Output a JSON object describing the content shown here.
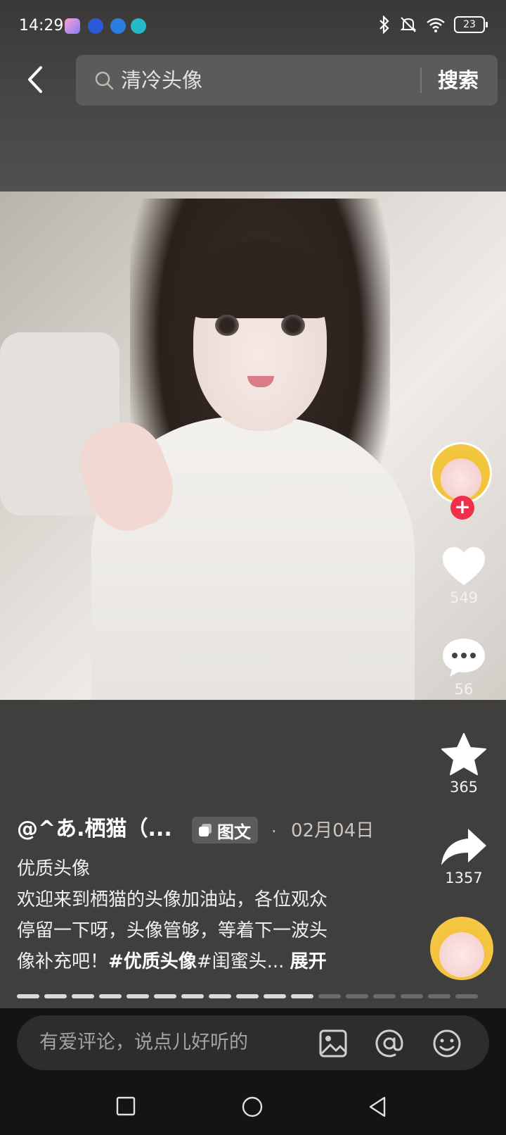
{
  "status_bar": {
    "time": "14:29",
    "battery": "23"
  },
  "search": {
    "query": "清冷头像",
    "submit_label": "搜索"
  },
  "post": {
    "author": "@^あ.栖猫（...",
    "type_tag": "图文",
    "date": "02月04日",
    "title": "优质头像",
    "body_line1": "欢迎来到栖猫的头像加油站，各位观众",
    "body_line2": "停留一下呀，头像管够，等着下一波头",
    "body_line3_prefix": "像补充吧！",
    "hashtag1": "#优质头像",
    "hashtag2_partial": "#闺蜜头...",
    "expand_label": "展开",
    "image_count": 17,
    "current_image": 11
  },
  "actions": {
    "likes": "549",
    "comments": "56",
    "favorites": "365",
    "shares": "1357"
  },
  "comment_input": {
    "placeholder": "有爱评论，说点儿好听的"
  },
  "colors": {
    "follow_red": "#f0304a",
    "background": "#444240"
  }
}
